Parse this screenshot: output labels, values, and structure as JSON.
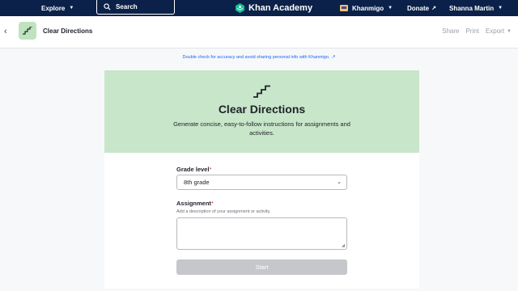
{
  "nav": {
    "explore": "Explore",
    "search_placeholder": "Search",
    "logo": "Khan Academy",
    "khanmigo": "Khanmigo",
    "donate": "Donate",
    "user_name": "Shanna Martin"
  },
  "subheader": {
    "tool_name": "Clear Directions",
    "share": "Share",
    "print": "Print",
    "export": "Export"
  },
  "disclaimer": "Double check for accuracy and avoid sharing personal info with Khanmigo.",
  "card": {
    "title": "Clear Directions",
    "description": "Generate concise, easy-to-follow instructions for assignments and activities.",
    "grade_label": "Grade level",
    "grade_value": "8th grade",
    "assignment_label": "Assignment",
    "assignment_hint": "Add a description of your assignment or activity.",
    "assignment_value": "",
    "start_label": "Start"
  },
  "colors": {
    "nav_bg": "#0b2149",
    "card_header_bg": "#c8e6c9",
    "link_blue": "#1865f2",
    "disabled_button": "#c5c7ca"
  },
  "icons": [
    "chevron-down-icon",
    "search-icon",
    "leaf-logo-icon",
    "khanmigo-icon",
    "external-link-icon",
    "back-arrow-icon",
    "stairs-icon",
    "resize-grip-icon"
  ]
}
